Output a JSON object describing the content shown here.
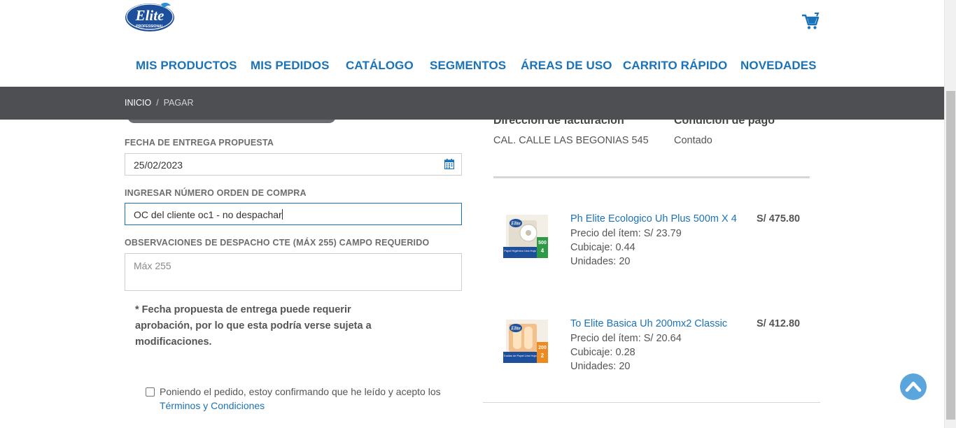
{
  "header": {
    "logo_text": "Elite",
    "logo_subtext": "PROFESSIONAL",
    "nav": [
      {
        "label": "MIS PRODUCTOS"
      },
      {
        "label": "MIS PEDIDOS"
      },
      {
        "label": "CATÁLOGO"
      },
      {
        "label": "SEGMENTOS"
      },
      {
        "label": "ÁREAS DE USO"
      },
      {
        "label": "CARRITO RÁPIDO"
      },
      {
        "label": "NOVEDADES"
      }
    ]
  },
  "breadcrumb": {
    "home": "INICIO",
    "separator": "/",
    "current": "PAGAR"
  },
  "form": {
    "delivery_date_label": "FECHA DE ENTREGA PROPUESTA",
    "delivery_date_value": "25/02/2023",
    "po_label": "INGRESAR NÚMERO ORDEN DE COMPRA",
    "po_value": "OC del cliente oc1 - no despachar",
    "obs_label": "OBSERVACIONES DE DESPACHO CTE (MÁX 255) CAMPO REQUERIDO",
    "obs_placeholder": "Máx 255",
    "note": "* Fecha propuesta de entrega puede requerir aprobación, por lo que esta podría verse sujeta a modificaciones.",
    "terms_text": "Poniendo el pedido, estoy confirmando que he leído y acepto los ",
    "terms_link": "Términos y Condiciones",
    "terms_checked": false
  },
  "summary": {
    "billing_label": "Dirección de facturación",
    "billing_value": "CAL. CALLE LAS BEGONIAS 545",
    "payment_label": "Condición de pago",
    "payment_value": "Contado"
  },
  "products": [
    {
      "name": "Ph Elite Ecologico Uh Plus 500m X 4",
      "price": "S/ 475.80",
      "unit_price": "Precio del ítem:  S/ 23.79",
      "cubicaje": "Cubicaje: 0.44",
      "units": "Unidades: 20",
      "package_number": "500",
      "package_count": "4",
      "package_caption": "Papel Higiénico Una Hoja",
      "accent": "#2e9a46"
    },
    {
      "name": "To Elite Basica Uh 200mx2 Classic",
      "price": "S/ 412.80",
      "unit_price": "Precio del ítem:  S/ 20.64",
      "cubicaje": "Cubicaje: 0.28",
      "units": "Unidades: 20",
      "package_number": "200",
      "package_count": "2",
      "package_caption": "Toallas de Papel Una Hoja",
      "accent": "#ee8a1f"
    }
  ],
  "colors": {
    "brand_blue": "#1a73b8",
    "breadcrumb_bg": "#4d4f52",
    "scroll_button": "#5aa6dc"
  }
}
